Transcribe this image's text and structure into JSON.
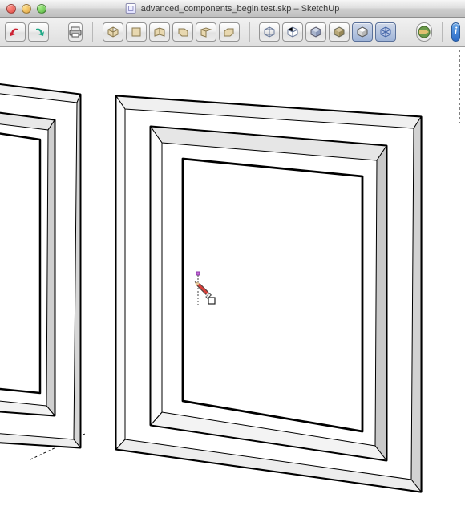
{
  "window": {
    "title": "advanced_components_begin test.skp – SketchUp"
  },
  "traffic_lights": {
    "close": "close",
    "minimize": "minimize",
    "zoom": "zoom"
  },
  "toolbar": {
    "undo": "Undo",
    "redo": "Redo",
    "print": "Print",
    "views": {
      "iso": "Iso",
      "top": "Top",
      "front": "Front",
      "right": "Right",
      "back": "Back",
      "left": "Left"
    },
    "styles": {
      "wireframe": "Wireframe",
      "hidden_line": "Hidden Line",
      "shaded": "Shaded",
      "shaded_textures": "Shaded With Textures",
      "monochrome": "Monochrome",
      "xray": "X-Ray"
    },
    "google": "Get Models",
    "info": "Info"
  },
  "cursor": {
    "tool": "Pencil / Line Tool"
  },
  "chart_data": null
}
